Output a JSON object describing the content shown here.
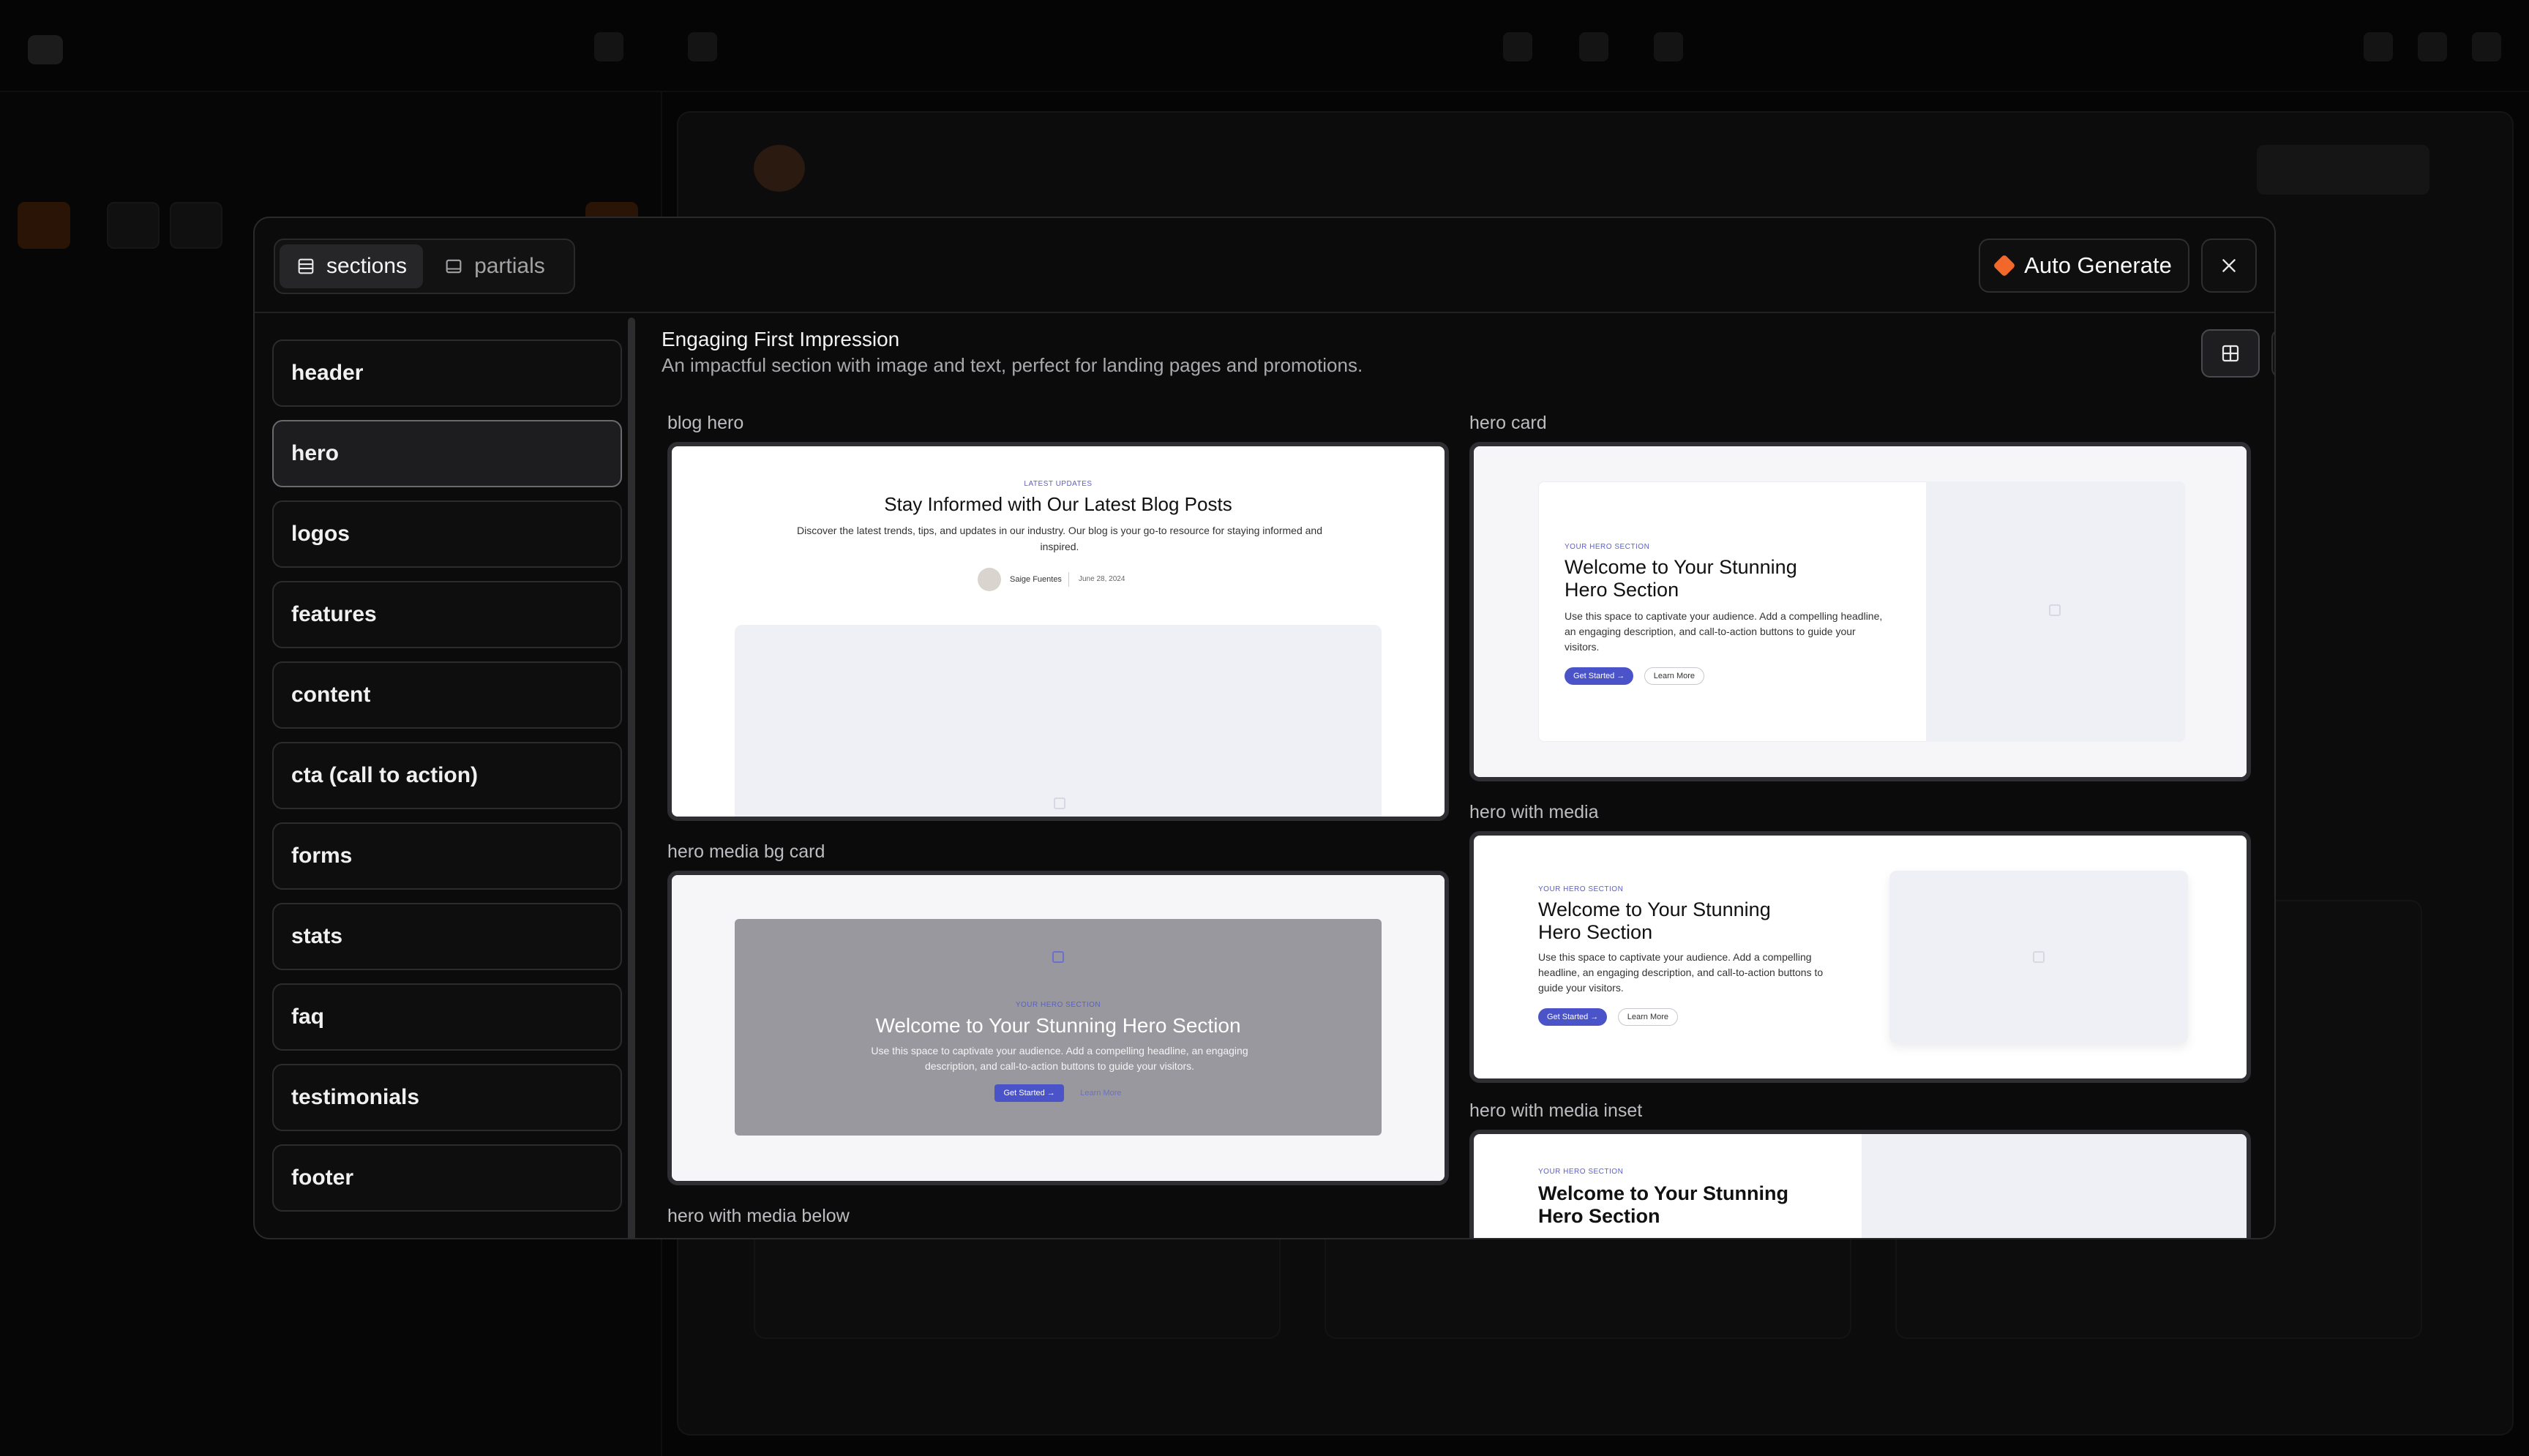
{
  "modal": {
    "tabs": [
      {
        "label": "sections",
        "icon": "sections-icon",
        "active": true
      },
      {
        "label": "partials",
        "icon": "partials-icon",
        "active": false
      }
    ],
    "auto_generate_label": "Auto Generate",
    "accent_color": "#f2672a"
  },
  "sidebar": {
    "items": [
      {
        "label": "header"
      },
      {
        "label": "hero",
        "active": true
      },
      {
        "label": "logos"
      },
      {
        "label": "features"
      },
      {
        "label": "content"
      },
      {
        "label": "cta (call to action)"
      },
      {
        "label": "forms"
      },
      {
        "label": "stats"
      },
      {
        "label": "faq"
      },
      {
        "label": "testimonials"
      },
      {
        "label": "footer"
      }
    ]
  },
  "main": {
    "title": "Engaging First Impression",
    "description": "An impactful section with image and text, perfect for landing pages and promotions.",
    "templates": [
      {
        "name": "blog hero"
      },
      {
        "name": "hero card"
      },
      {
        "name": "hero media bg card"
      },
      {
        "name": "hero with media"
      },
      {
        "name": "hero with media below"
      },
      {
        "name": "hero with media inset"
      }
    ]
  },
  "previews": {
    "blog": {
      "eyebrow": "LATEST UPDATES",
      "title": "Stay Informed with Our Latest Blog Posts",
      "desc": "Discover the latest trends, tips, and updates in our industry. Our blog is your go-to resource for staying informed and inspired.",
      "author": "Saige Fuentes",
      "date": "June 28, 2024"
    },
    "hero": {
      "eyebrow": "YOUR HERO SECTION",
      "title_line1": "Welcome to Your Stunning",
      "title_line2": "Hero Section",
      "title_full": "Welcome to Your Stunning Hero Section",
      "desc": "Use this space to captivate your audience. Add a compelling headline, an engaging description, and call-to-action buttons to guide your visitors.",
      "primary": "Get Started →",
      "secondary": "Learn More"
    }
  }
}
